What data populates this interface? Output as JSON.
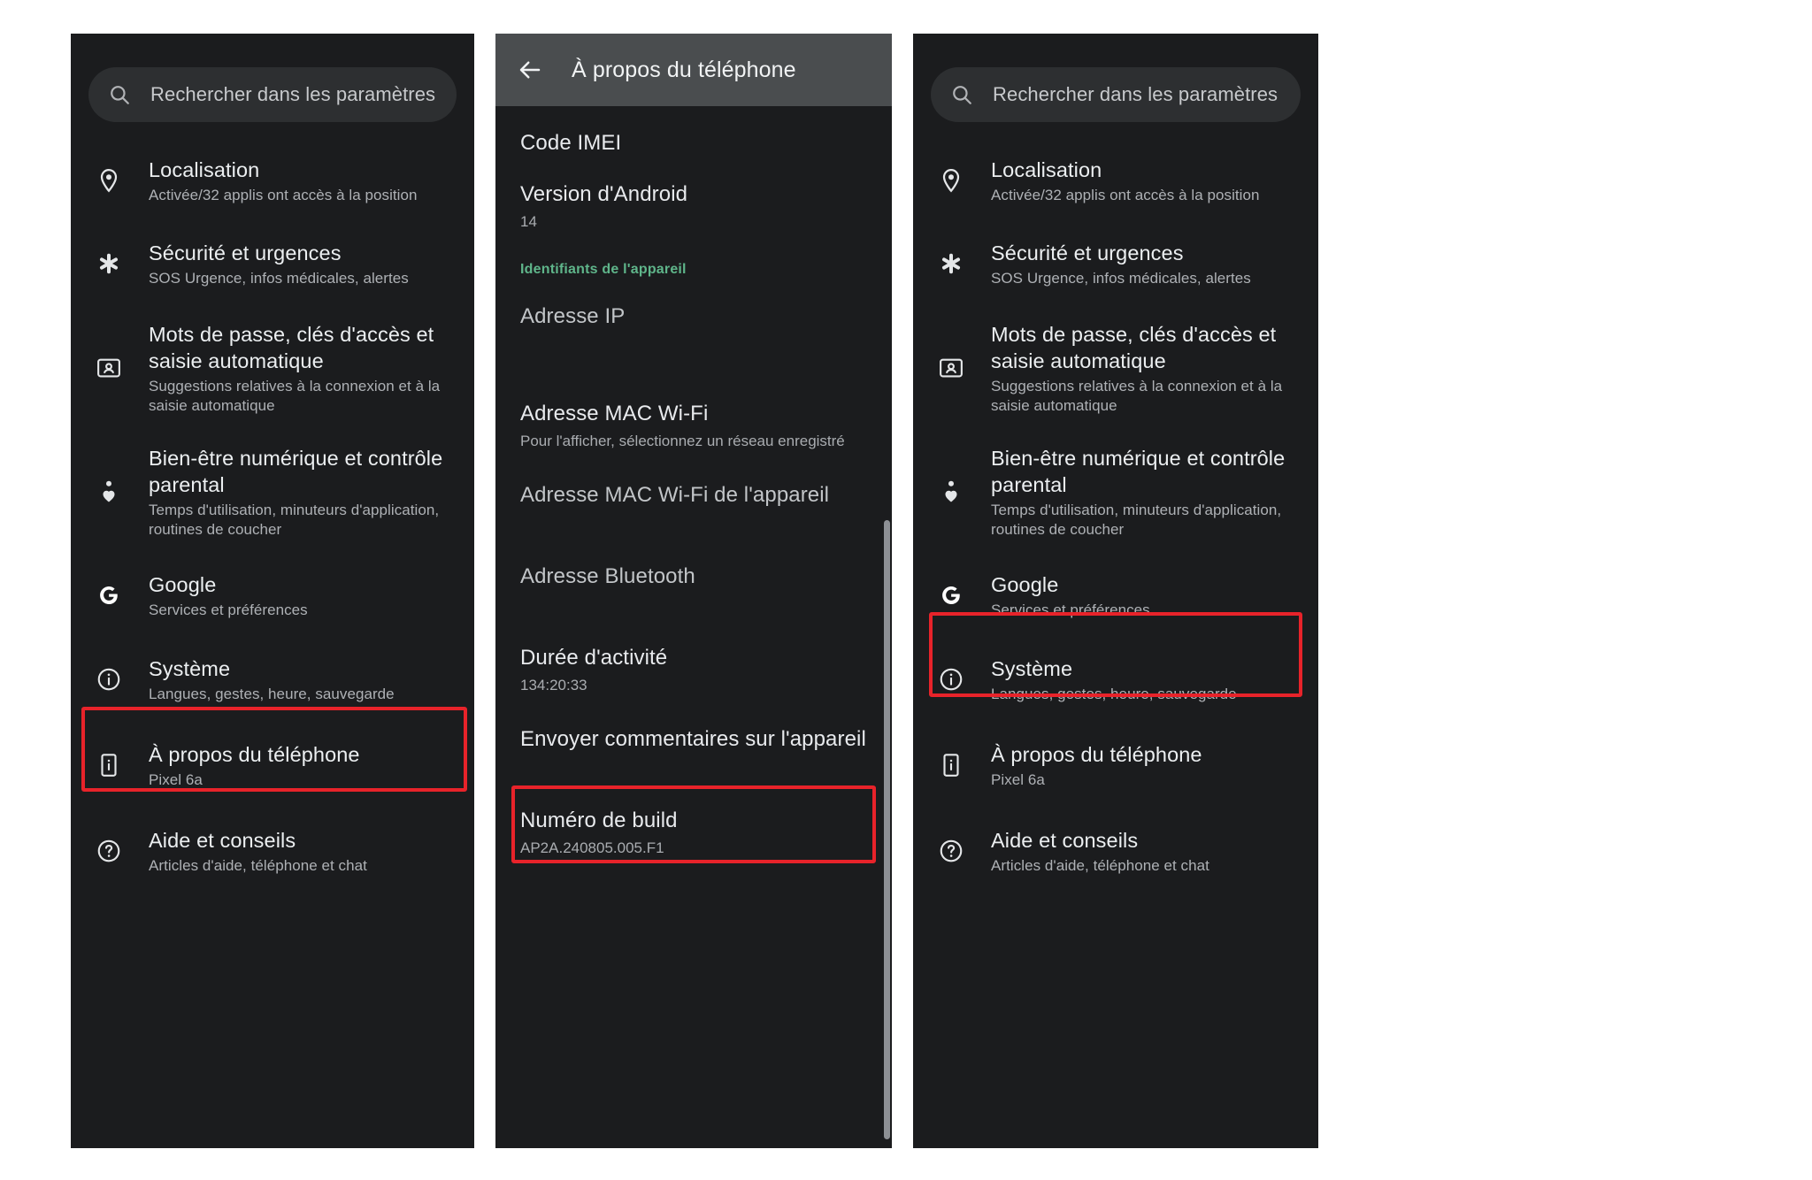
{
  "panels": {
    "settings_left": {
      "search": {
        "placeholder": "Rechercher dans les paramètres",
        "icon": "search-icon"
      },
      "items": [
        {
          "icon": "location-pin-icon",
          "title": "Localisation",
          "sub": "Activée/32 applis ont accès à la position"
        },
        {
          "icon": "emergency-asterisk-icon",
          "title": "Sécurité et urgences",
          "sub": "SOS Urgence, infos médicales, alertes"
        },
        {
          "icon": "passwords-card-icon",
          "title": "Mots de passe, clés d'accès et saisie automatique",
          "sub": "Suggestions relatives à la connexion et à la saisie automatique"
        },
        {
          "icon": "digital-wellbeing-icon",
          "title": "Bien-être numérique et contrôle parental",
          "sub": "Temps d'utilisation, minuteurs d'application, routines de coucher"
        },
        {
          "icon": "google-g-icon",
          "title": "Google",
          "sub": "Services et préférences"
        },
        {
          "icon": "info-circle-icon",
          "title": "Système",
          "sub": "Langues, gestes, heure, sauvegarde"
        },
        {
          "icon": "phone-info-icon",
          "title": "À propos du téléphone",
          "sub": "Pixel 6a"
        },
        {
          "icon": "help-circle-icon",
          "title": "Aide et conseils",
          "sub": "Articles d'aide, téléphone et chat"
        }
      ],
      "highlighted_item": "À propos du téléphone"
    },
    "about_phone": {
      "header": {
        "back_icon": "back-arrow-icon",
        "title": "À propos du téléphone"
      },
      "items": [
        {
          "title": "Code IMEI",
          "sub": ""
        },
        {
          "title": "Version d'Android",
          "sub": "14"
        },
        {
          "section": "Identifiants de l'appareil"
        },
        {
          "title": "Adresse IP",
          "sub": ""
        },
        {
          "title": "Adresse MAC Wi-Fi",
          "sub": "Pour l'afficher, sélectionnez un réseau enregistré"
        },
        {
          "title": "Adresse MAC Wi-Fi de l'appareil",
          "sub": ""
        },
        {
          "title": "Adresse Bluetooth",
          "sub": ""
        },
        {
          "title": "Durée d'activité",
          "sub": "134:20:33"
        },
        {
          "title": "Envoyer commentaires sur l'appareil",
          "sub": ""
        },
        {
          "title": "Numéro de build",
          "sub": "AP2A.240805.005.F1"
        }
      ],
      "section_label": "Identifiants de l'appareil",
      "highlighted_item": "Numéro de build"
    },
    "settings_right": {
      "search": {
        "placeholder": "Rechercher dans les paramètres",
        "icon": "search-icon"
      },
      "items": [
        {
          "icon": "location-pin-icon",
          "title": "Localisation",
          "sub": "Activée/32 applis ont accès à la position"
        },
        {
          "icon": "emergency-asterisk-icon",
          "title": "Sécurité et urgences",
          "sub": "SOS Urgence, infos médicales, alertes"
        },
        {
          "icon": "passwords-card-icon",
          "title": "Mots de passe, clés d'accès et saisie automatique",
          "sub": "Suggestions relatives à la connexion et à la saisie automatique"
        },
        {
          "icon": "digital-wellbeing-icon",
          "title": "Bien-être numérique et contrôle parental",
          "sub": "Temps d'utilisation, minuteurs d'application, routines de coucher"
        },
        {
          "icon": "google-g-icon",
          "title": "Google",
          "sub": "Services et préférences"
        },
        {
          "icon": "info-circle-icon",
          "title": "Système",
          "sub": "Langues, gestes, heure, sauvegarde"
        },
        {
          "icon": "phone-info-icon",
          "title": "À propos du téléphone",
          "sub": "Pixel 6a"
        },
        {
          "icon": "help-circle-icon",
          "title": "Aide et conseils",
          "sub": "Articles d'aide, téléphone et chat"
        }
      ],
      "highlighted_item": "Système"
    }
  },
  "colors": {
    "panel_background": "#1b1c1e",
    "search_field": "#2d2f31",
    "header_bar": "#4a4d4f",
    "highlight_red": "#e8232a",
    "section_green": "#5fb58a",
    "primary_text": "#eceff1",
    "secondary_text": "#aeb1b5",
    "page_background": "#ffffff"
  }
}
